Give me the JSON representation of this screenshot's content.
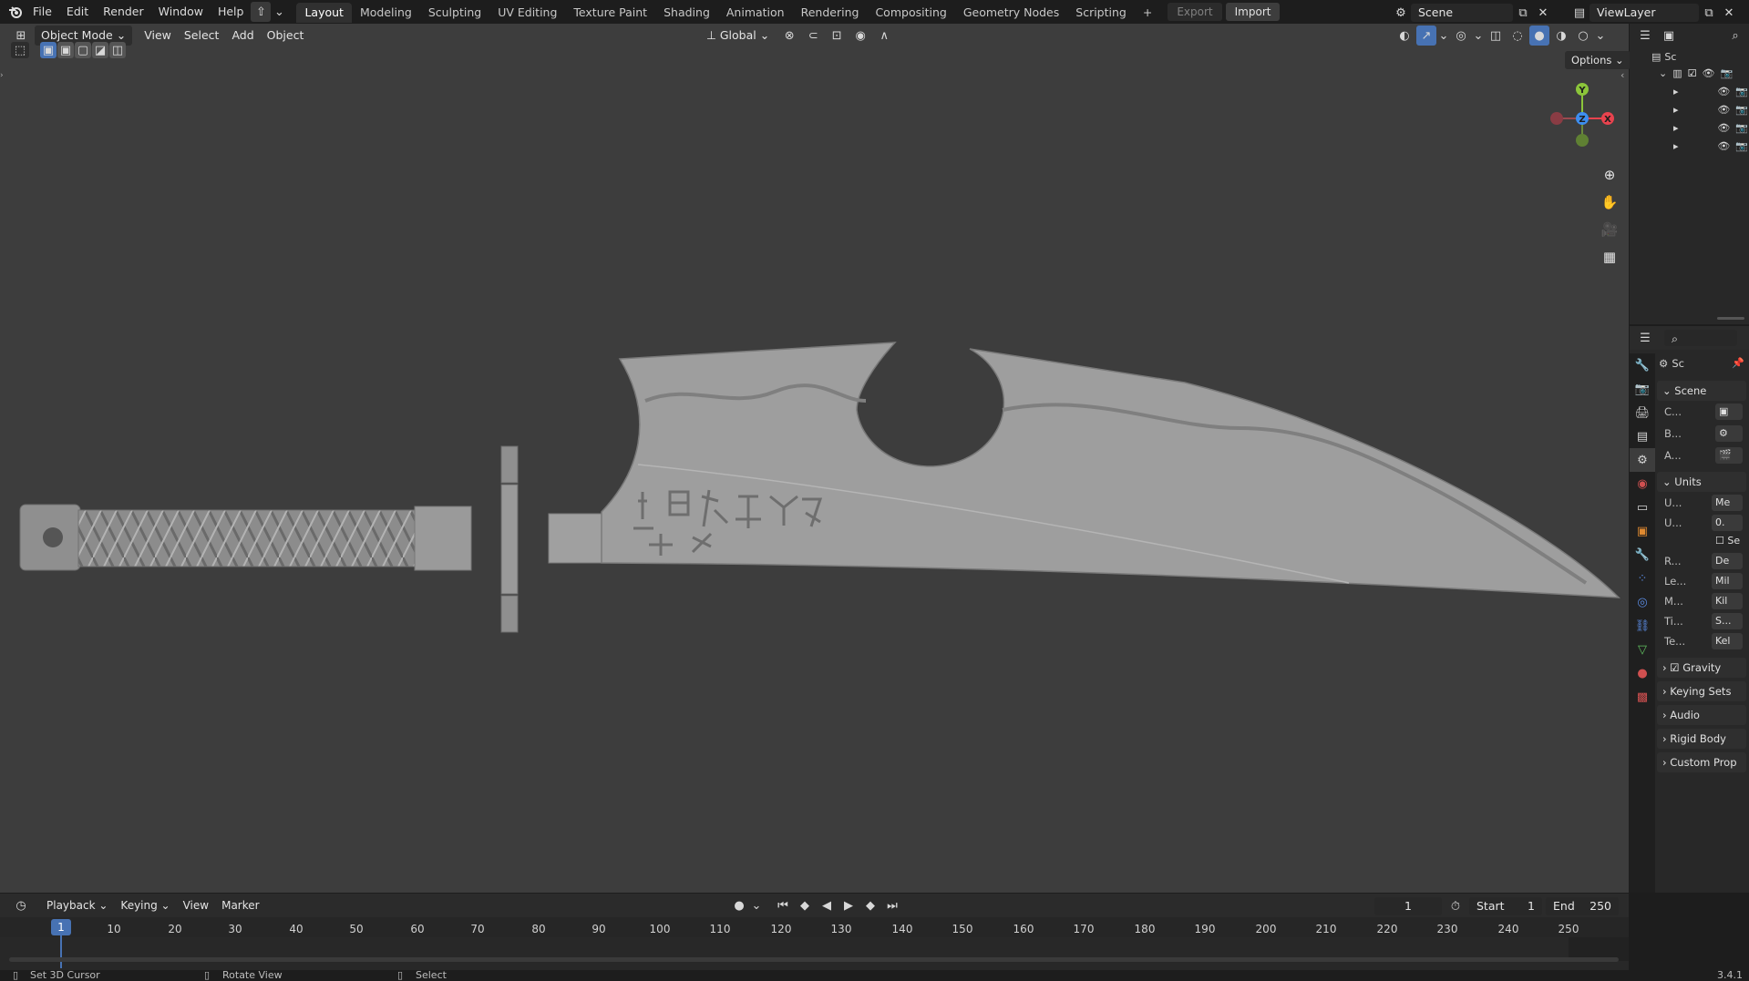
{
  "menu": {
    "items": [
      "File",
      "Edit",
      "Render",
      "Window",
      "Help"
    ],
    "workspaces": [
      "Layout",
      "Modeling",
      "Sculpting",
      "UV Editing",
      "Texture Paint",
      "Shading",
      "Animation",
      "Rendering",
      "Compositing",
      "Geometry Nodes",
      "Scripting"
    ],
    "active_workspace": "Layout",
    "add_tab": "+",
    "export_label": "Export",
    "import_label": "Import",
    "scene_name": "Scene",
    "view_layer": "ViewLayer"
  },
  "viewport": {
    "mode": "Object Mode",
    "menus": [
      "View",
      "Select",
      "Add",
      "Object"
    ],
    "transform_orientation": "Global",
    "options_label": "Options",
    "gizmo": {
      "x": "X",
      "y": "Y",
      "z": "Z"
    }
  },
  "outliner": {
    "root_label": "Sc",
    "rows": 4
  },
  "properties": {
    "header": "Sc",
    "scene_panel": "Scene",
    "scene_rows": [
      {
        "label": "C..."
      },
      {
        "label": "B..."
      },
      {
        "label": "A..."
      }
    ],
    "units_panel": "Units",
    "units_rows": [
      {
        "label": "U...",
        "value": "Me"
      },
      {
        "label": "U...",
        "value": "0."
      },
      {
        "label": "",
        "value": "Se"
      },
      {
        "label": "R...",
        "value": "De"
      },
      {
        "label": "Le...",
        "value": "Mil"
      },
      {
        "label": "M...",
        "value": "Kil"
      },
      {
        "label": "Ti...",
        "value": "S..."
      },
      {
        "label": "Te...",
        "value": "Kel"
      }
    ],
    "collapsed_panels": [
      "Gravity",
      "Keying Sets",
      "Audio",
      "Rigid Body",
      "Custom Prop"
    ]
  },
  "timeline": {
    "menus": [
      "Playback",
      "Keying",
      "View",
      "Marker"
    ],
    "current_frame": "1",
    "start_label": "Start",
    "start": "1",
    "end_label": "End",
    "end": "250",
    "playhead": "1",
    "ticks": [
      "10",
      "20",
      "30",
      "40",
      "50",
      "60",
      "70",
      "80",
      "90",
      "100",
      "110",
      "120",
      "130",
      "140",
      "150",
      "160",
      "170",
      "180",
      "190",
      "200",
      "210",
      "220",
      "230",
      "240",
      "250"
    ]
  },
  "statusbar": {
    "hint1": "Set 3D Cursor",
    "hint2": "Rotate View",
    "hint3": "Select",
    "version": "3.4.1"
  },
  "colors": {
    "accent": "#4772b3",
    "viewport_bg": "#3d3d3d",
    "model": "#9a9a9a",
    "axis_x": "#e8434e",
    "axis_y": "#8bc53a",
    "axis_z": "#3d8ef0"
  }
}
